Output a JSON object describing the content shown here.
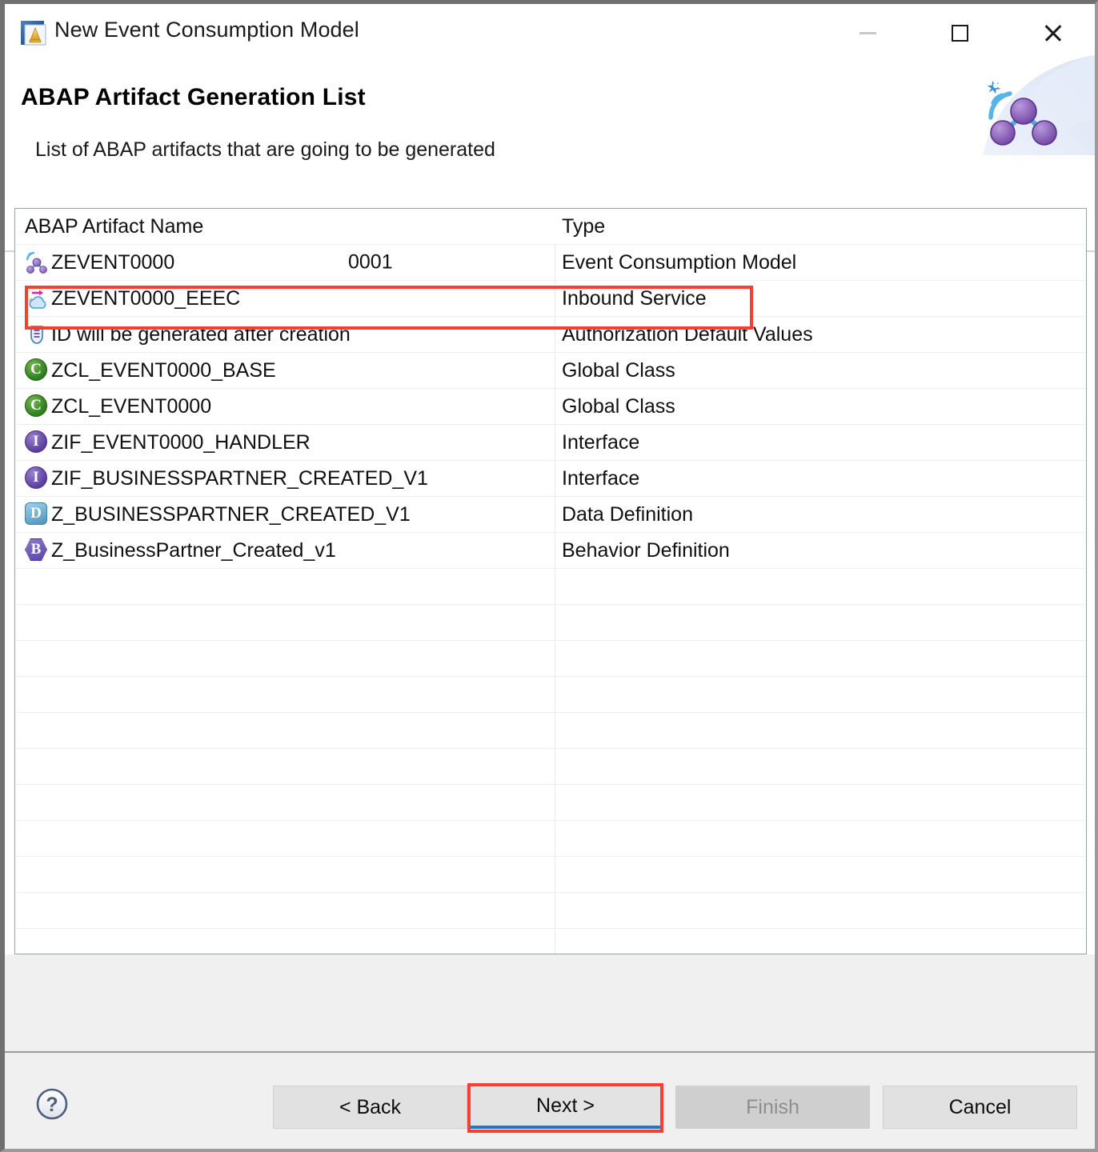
{
  "window": {
    "title": "New Event Consumption Model",
    "icon": "wizard-icon",
    "controls": {
      "minimize": "minimize-icon",
      "maximize": "maximize-icon",
      "close": "close-icon"
    }
  },
  "header": {
    "title": "ABAP Artifact Generation List",
    "subtitle": "List of ABAP artifacts that are going to be generated",
    "banner_icon": "event-mesh-nodes-icon"
  },
  "table": {
    "columns": [
      "ABAP Artifact Name",
      "Type"
    ],
    "rows": [
      {
        "icon": "event-consumption-model-icon",
        "name": "ZEVENT0000",
        "number": "0001",
        "type": "Event Consumption Model",
        "highlighted": false
      },
      {
        "icon": "inbound-service-cloud-icon",
        "name": "ZEVENT0000_EEEC",
        "number": "",
        "type": "Inbound Service",
        "highlighted": true
      },
      {
        "icon": "authorization-shield-icon",
        "name": "ID will be generated after creation",
        "number": "",
        "type": "Authorization Default Values",
        "highlighted": false
      },
      {
        "icon": "global-class-icon",
        "name": "ZCL_EVENT0000_BASE",
        "number": "",
        "type": "Global Class",
        "highlighted": false
      },
      {
        "icon": "global-class-icon",
        "name": "ZCL_EVENT0000",
        "number": "",
        "type": "Global Class",
        "highlighted": false
      },
      {
        "icon": "interface-icon",
        "name": "ZIF_EVENT0000_HANDLER",
        "number": "",
        "type": "Interface",
        "highlighted": false
      },
      {
        "icon": "interface-icon",
        "name": "ZIF_BUSINESSPARTNER_CREATED_V1",
        "number": "",
        "type": "Interface",
        "highlighted": false
      },
      {
        "icon": "data-definition-icon",
        "name": "Z_BUSINESSPARTNER_CREATED_V1",
        "number": "",
        "type": "Data Definition",
        "highlighted": false
      },
      {
        "icon": "behavior-definition-icon",
        "name": "Z_BusinessPartner_Created_v1",
        "number": "",
        "type": "Behavior Definition",
        "highlighted": false
      }
    ],
    "empty_row_count": 11
  },
  "footer": {
    "help_icon": "help-question-icon",
    "buttons": {
      "back": "< Back",
      "next": "Next >",
      "finish": "Finish",
      "cancel": "Cancel"
    },
    "finish_disabled": true,
    "default_button": "Next >"
  },
  "annotations": {
    "highlight_color": "#f4402f",
    "targets": [
      "inbound-service-row",
      "next-button"
    ]
  },
  "colors": {
    "accent_blue": "#1a7ac9",
    "dialog_bg": "#f0f0f0",
    "table_bg": "#ffffff",
    "highlight": "#f4402f"
  }
}
